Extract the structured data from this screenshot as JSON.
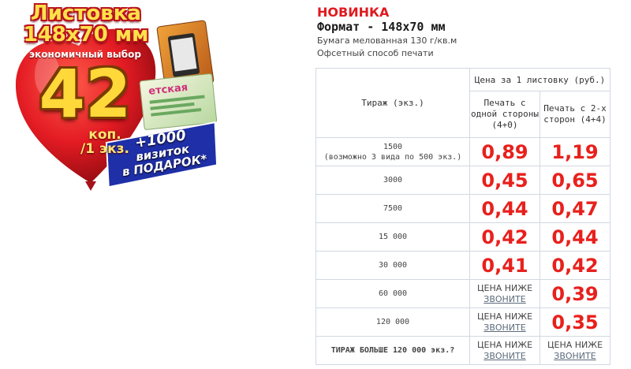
{
  "promo": {
    "title_line1": "Листовка",
    "title_line2": "148x70 мм",
    "subtitle": "экономичный выбор",
    "price": "42",
    "unit_line1": "коп.",
    "unit_line2": "/1 экз.",
    "gift_line1": "+1000",
    "gift_line2": "визиток",
    "gift_line3": "в ПОДАРОК*",
    "colors": {
      "balloon": "#e31b23",
      "price_gold": "#ffd83a",
      "gift_banner": "#1f2fa8"
    }
  },
  "header": {
    "new_label": "НОВИНКА",
    "format": "Формат - 148х70 мм",
    "paper": "Бумага мелованная 130 г/кв.м",
    "print_method": "Офсетный способ печати"
  },
  "table": {
    "col_tirazh": "Тираж (экз.)",
    "price_header": "Цена за 1 листовку (руб.)",
    "col_one_side": "Печать с одной стороны (4+0)",
    "col_two_side": "Печать с 2-х сторон (4+4)",
    "rows": [
      {
        "tirazh": "1500",
        "note": "(возможно 3 вида по 500 экз.)",
        "one": "0,89",
        "two": "1,19"
      },
      {
        "tirazh": "3000",
        "one": "0,45",
        "two": "0,65"
      },
      {
        "tirazh": "7500",
        "one": "0,44",
        "two": "0,47"
      },
      {
        "tirazh": "15 000",
        "one": "0,42",
        "two": "0,44"
      },
      {
        "tirazh": "30 000",
        "one": "0,41",
        "two": "0,42"
      },
      {
        "tirazh": "60 000",
        "two": "0,39"
      },
      {
        "tirazh": "120 000",
        "two": "0,35"
      },
      {
        "tirazh": "ТИРАЖ БОЛЬШЕ 120 000 экз.?"
      }
    ],
    "lower_price": "ЦЕНА НИЖЕ",
    "call_link": "ЗВОНИТЕ",
    "colors": {
      "price": "#e8201c",
      "border": "#d2d8e0"
    }
  }
}
